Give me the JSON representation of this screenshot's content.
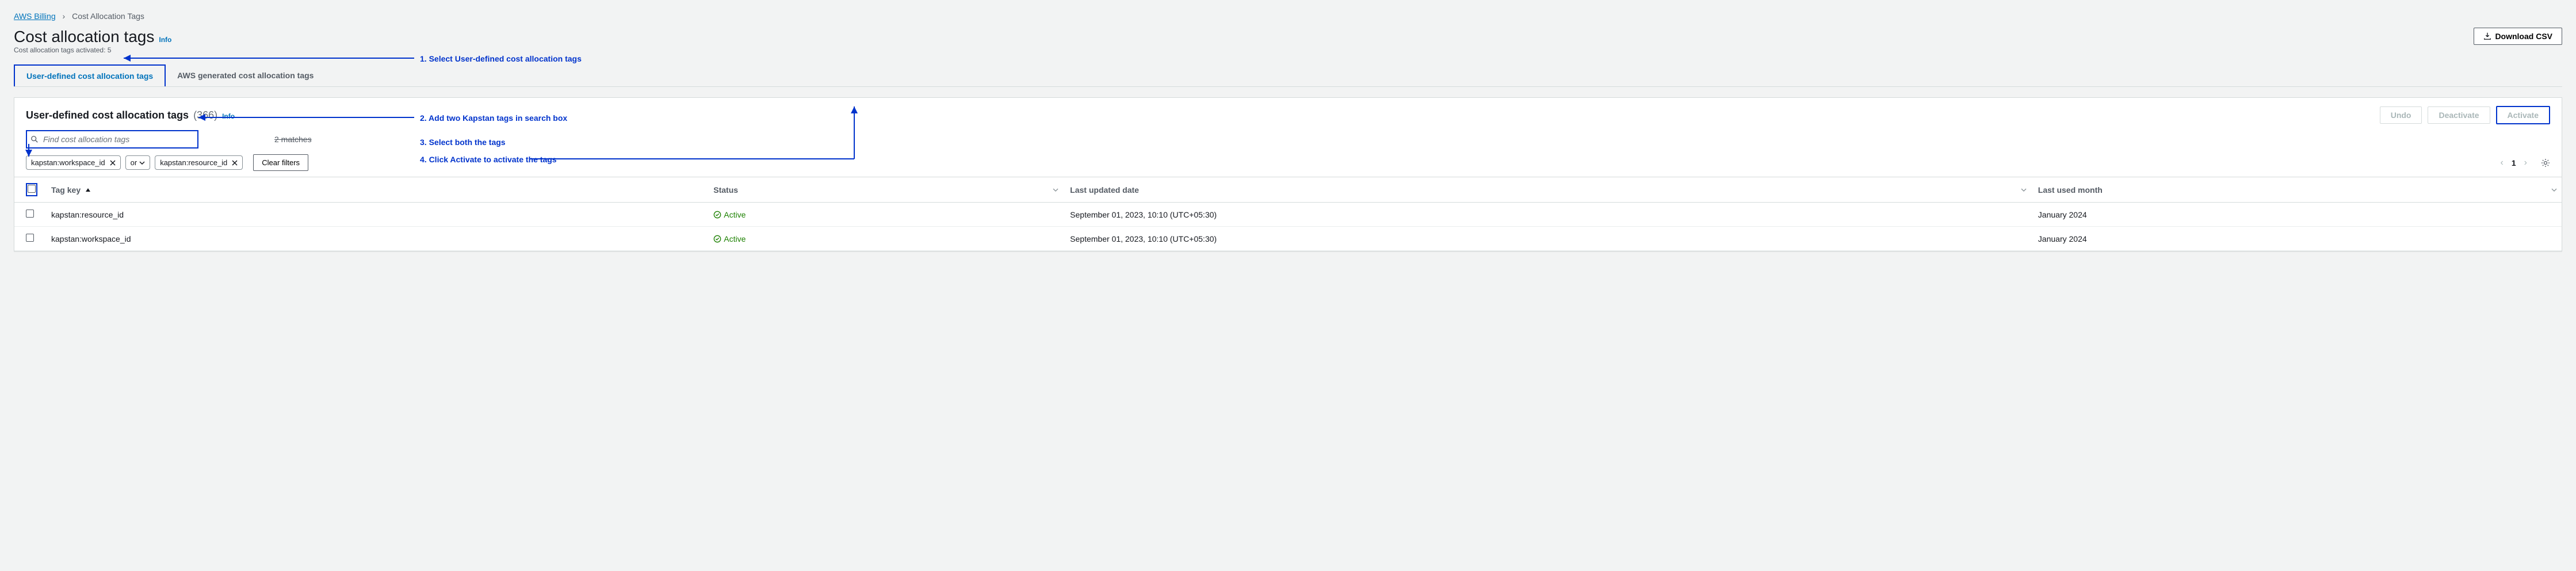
{
  "breadcrumb": {
    "root": "AWS Billing",
    "current": "Cost Allocation Tags"
  },
  "header": {
    "title": "Cost allocation tags",
    "info": "Info",
    "subtitle": "Cost allocation tags activated: 5",
    "download": "Download CSV"
  },
  "tabs": [
    {
      "label": "User-defined cost allocation tags",
      "active": true
    },
    {
      "label": "AWS generated cost allocation tags",
      "active": false
    }
  ],
  "panel": {
    "title": "User-defined cost allocation tags",
    "count": "(366)",
    "info": "Info",
    "actions": {
      "undo": "Undo",
      "deactivate": "Deactivate",
      "activate": "Activate"
    },
    "search_placeholder": "Find cost allocation tags",
    "matches": "2 matches",
    "clear": "Clear filters",
    "or": "or",
    "pagination": {
      "page": "1"
    }
  },
  "chips": [
    {
      "label": "kapstan:workspace_id"
    },
    {
      "label": "kapstan:resource_id"
    }
  ],
  "columns": {
    "tag_key": "Tag key",
    "status": "Status",
    "last_updated": "Last updated date",
    "last_used": "Last used month"
  },
  "rows": [
    {
      "tag_key": "kapstan:resource_id",
      "status": "Active",
      "last_updated": "September 01, 2023, 10:10 (UTC+05:30)",
      "last_used": "January 2024"
    },
    {
      "tag_key": "kapstan:workspace_id",
      "status": "Active",
      "last_updated": "September 01, 2023, 10:10 (UTC+05:30)",
      "last_used": "January 2024"
    }
  ],
  "annotations": {
    "a1": "1. Select User-defined cost allocation tags",
    "a2": "2. Add two Kapstan tags in search box",
    "a3": "3. Select both the tags",
    "a4": "4. Click Activate to activate the tags"
  }
}
